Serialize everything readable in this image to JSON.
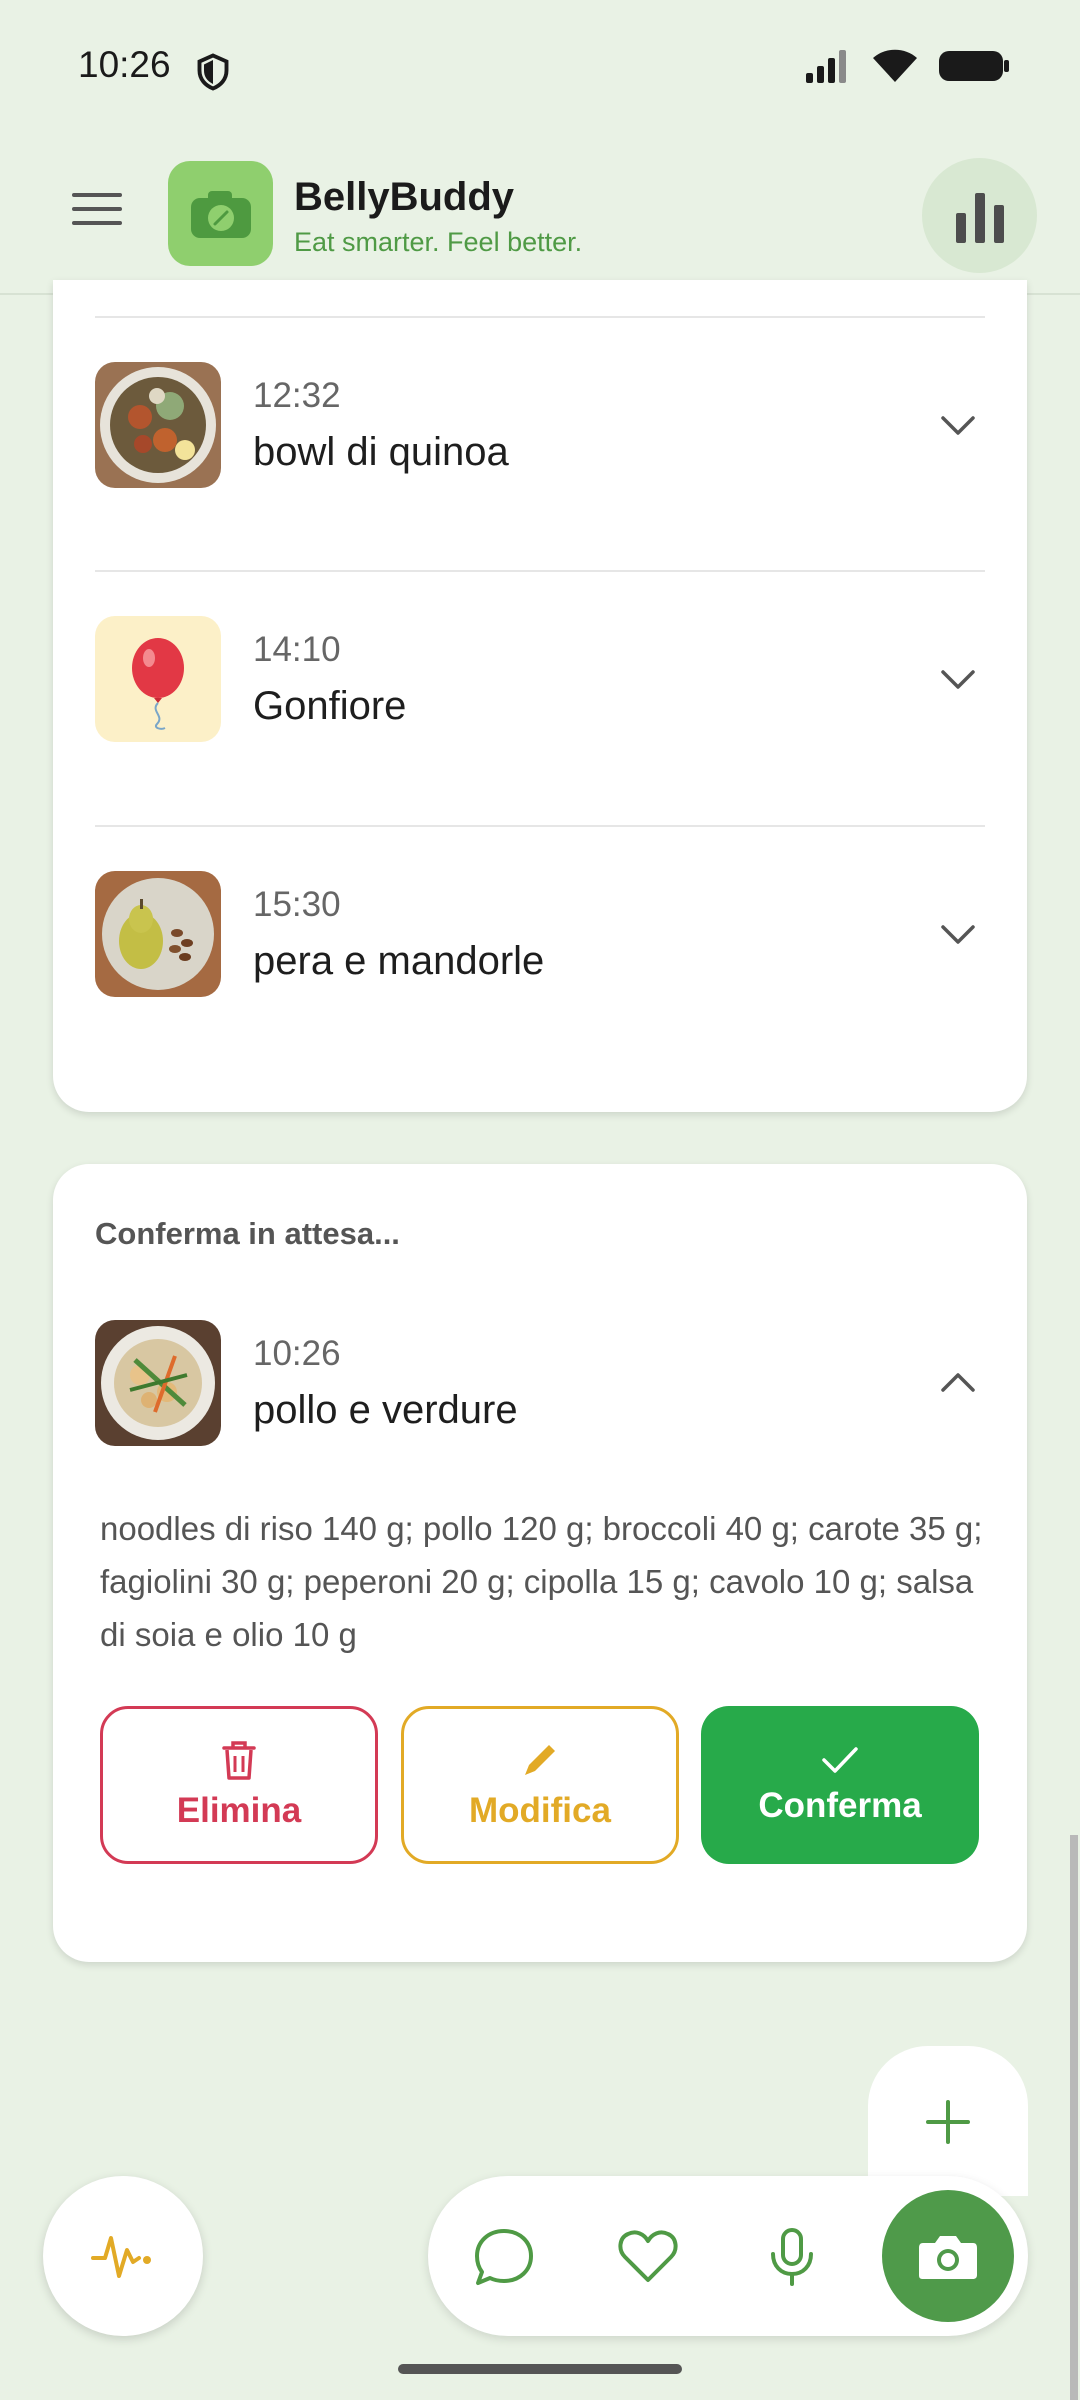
{
  "status_bar": {
    "time": "10:26"
  },
  "app_bar": {
    "title": "BellyBuddy",
    "tagline": "Eat smarter. Feel better."
  },
  "entries": [
    {
      "time": "12:32",
      "title": "bowl di quinoa",
      "icon": "quinoa-bowl-photo"
    },
    {
      "time": "14:10",
      "title": "Gonfiore",
      "icon": "balloon-icon"
    },
    {
      "time": "15:30",
      "title": "pera e mandorle",
      "icon": "pear-almonds-photo"
    }
  ],
  "pending": {
    "label": "Conferma in attesa...",
    "time": "10:26",
    "title": "pollo e verdure",
    "description": "noodles di riso 140 g; pollo 120 g; broccoli 40 g; carote 35 g; fagiolini 30 g; peperoni 20 g; cipolla 15 g; cavolo 10 g; salsa di soia e olio 10 g",
    "actions": {
      "delete_label": "Elimina",
      "edit_label": "Modifica",
      "confirm_label": "Conferma"
    }
  },
  "colors": {
    "background": "#e9f2e5",
    "brand_green": "#4f9a45",
    "delete": "#d33a55",
    "edit": "#e2aa26",
    "confirm": "#27aa4a"
  }
}
